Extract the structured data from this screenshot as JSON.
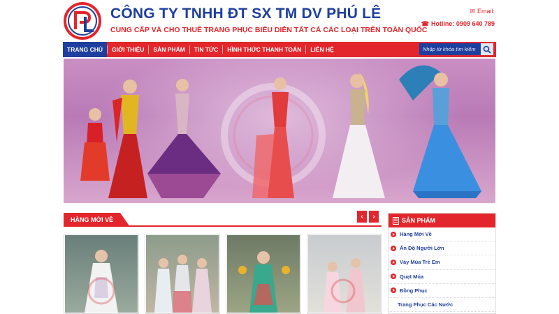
{
  "header": {
    "company_name": "CÔNG TY TNHH ĐT SX TM DV PHÚ LÊ",
    "tagline": "CUNG CẤP VÀ CHO THUÊ TRANG PHỤC BIỂU DIỄN TẤT CẢ CÁC LOẠI TRÊN TOÀN QUỐC",
    "email_label": "Email:",
    "hotline": "Hotline: 0909 640 789",
    "logo_text": "PL"
  },
  "nav": {
    "items": [
      "TRANG CHỦ",
      "GIỚI THIỆU",
      "SẢN PHẨM",
      "TIN TỨC",
      "HÌNH THỨC THANH TOÁN",
      "LIÊN HỆ"
    ],
    "search_placeholder": "Nhập từ khóa tìm kiếm"
  },
  "main": {
    "section_title": "HÀNG MỚI VỀ",
    "prev_label": "‹",
    "next_label": "›"
  },
  "sidebar": {
    "title": "SẢN PHẨM",
    "items": [
      "Hàng Mới Về",
      "Ấn Độ Người Lớn",
      "Váy Múa Trẻ Em",
      "Quạt Múa",
      "Đồng Phục",
      "Trang Phục Các Nước"
    ]
  },
  "colors": {
    "brand_red": "#e3262c",
    "brand_blue": "#1f3f9e"
  },
  "icons": {
    "email": "envelope-icon",
    "hotline": "phone-icon",
    "search": "search-icon",
    "sidebar": "document-icon"
  }
}
